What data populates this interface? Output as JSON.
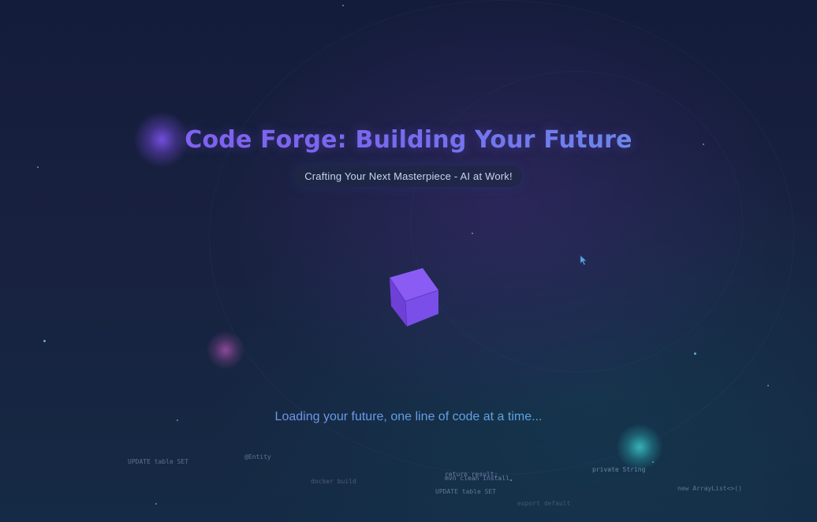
{
  "hero": {
    "title": "Code Forge: Building Your Future",
    "subtitle": "Crafting Your Next Masterpiece - AI at Work!"
  },
  "loading": {
    "message": "Loading your future, one line of code at a time..."
  },
  "code_snippets": [
    "UPDATE table SET",
    "@Entity",
    "docker build",
    "return result;",
    "mvn clean install",
    "UPDATE table SET",
    "export default",
    "private String",
    "new ArrayList<>()"
  ],
  "colors": {
    "title_gradient_start": "#8a5cf0",
    "title_gradient_end": "#5fa8e6",
    "cube_face": "#7a4ee8",
    "background": "#141c3b"
  },
  "icons": {
    "cube": "loading-cube-icon",
    "cursor": "mouse-pointer-icon"
  }
}
